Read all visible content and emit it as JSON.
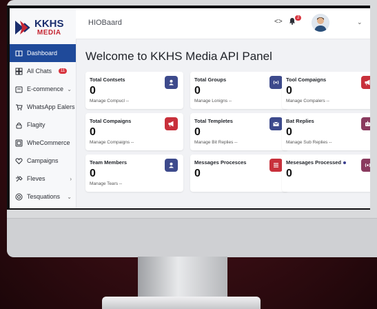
{
  "app": {
    "title": "HIOBaard"
  },
  "logo": {
    "line1": "KKHS",
    "line2": "MEDIA"
  },
  "sidebar": {
    "items": [
      {
        "label": "Dashboard",
        "icon": "book-icon",
        "active": true
      },
      {
        "label": "All Chats",
        "icon": "grid-icon",
        "badge": "11"
      },
      {
        "label": "E-commence",
        "icon": "cart-box-icon",
        "chevron": "⌄"
      },
      {
        "label": "WhatsApp Ealers",
        "icon": "cart-icon"
      },
      {
        "label": "Flagity",
        "icon": "lock-icon"
      },
      {
        "label": "WheCommerce",
        "icon": "square-icon"
      },
      {
        "label": "Campaigns",
        "icon": "heart-icon"
      },
      {
        "label": "Fleves",
        "icon": "tools-icon",
        "chevron": "›"
      },
      {
        "label": "Tesquations",
        "icon": "target-icon",
        "chevron": "⌄"
      }
    ]
  },
  "header": {
    "code_icon": "<>",
    "notifications": "2"
  },
  "main": {
    "title": "Welcome to KKHS Media API Panel"
  },
  "cards": [
    {
      "title": "Total Contsets",
      "value": "0",
      "sub": "Manage Compucl --",
      "icon": "user-icon",
      "color": "#3d4a8c"
    },
    {
      "title": "Total Groups",
      "value": "0",
      "sub": "Manage Lonigns --",
      "icon": "broadcast-icon",
      "color": "#3d4a8c"
    },
    {
      "title": "Tool Compaigns",
      "value": "0",
      "sub": "Manage Compalers --",
      "icon": "megaphone-icon",
      "color": "#c8303b"
    },
    {
      "title": "Total Compaigns",
      "value": "0",
      "sub": "Manage Compaigns --",
      "icon": "megaphone-icon",
      "color": "#c8303b"
    },
    {
      "title": "Total Templetes",
      "value": "0",
      "sub": "Manage Bit Replies --",
      "icon": "mail-icon",
      "color": "#3d4a8c"
    },
    {
      "title": "Bat Replies",
      "value": "0",
      "sub": "Manage Sub Replies --",
      "icon": "bot-icon",
      "color": "#8a3b5f"
    },
    {
      "title": "Team Members",
      "value": "0",
      "sub": "Manage Tears --",
      "icon": "user-icon",
      "color": "#3d4a8c"
    },
    {
      "title": "Messages Procesces",
      "value": "0",
      "sub": "",
      "icon": "list-icon",
      "color": "#c8303b"
    },
    {
      "title": "Mesesages Processed",
      "value": "0",
      "sub": "",
      "icon": "broadcast-icon",
      "color": "#8a3b5f",
      "dot": true
    }
  ]
}
